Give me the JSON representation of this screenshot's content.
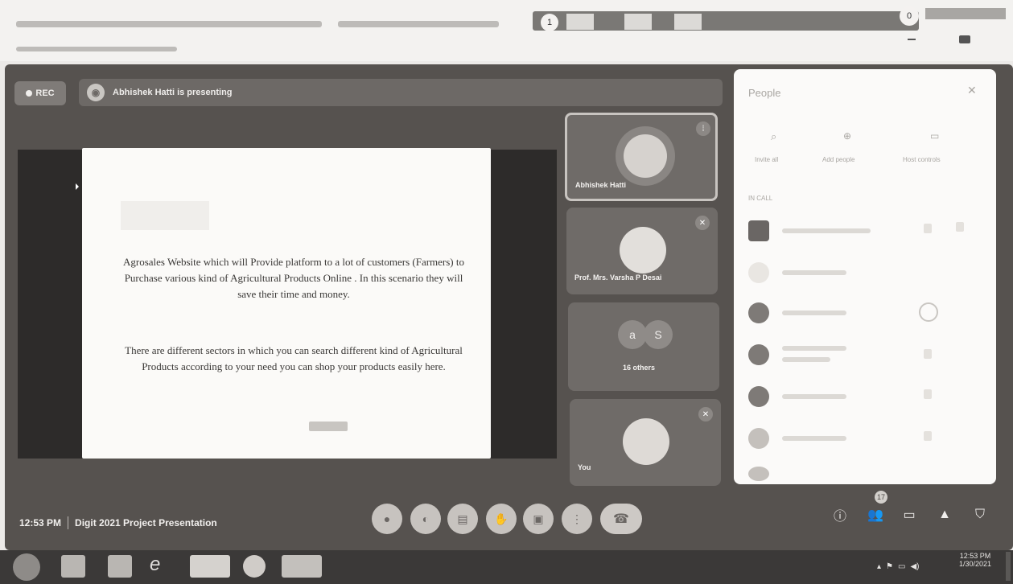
{
  "browser": {
    "tab_badge_1": "1",
    "tab_badge_2": "0"
  },
  "meeting": {
    "rec_label": "REC",
    "presenter_text": "Abhishek Hatti is presenting",
    "time": "12:53 PM",
    "title": "Digit 2021 Project Presentation"
  },
  "slide": {
    "paragraph_1": "Agrosales Website which will Provide platform to a lot of customers (Farmers) to Purchase various kind of Agricultural Products Online . In this scenario they will save their time and money.",
    "paragraph_2": "There are different sectors in which you can search different kind of Agricultural Products according to your need you can shop your products easily here."
  },
  "tiles": [
    {
      "name": "Abhishek Hatti",
      "active": true
    },
    {
      "name": "Prof. Mrs. Varsha P Desai",
      "active": false
    },
    {
      "name": "16 others",
      "initials": [
        "a",
        "S"
      ],
      "active": false
    },
    {
      "name": "You",
      "active": false
    }
  ],
  "people_panel": {
    "title": "People",
    "close_icon": "close-icon",
    "actions": [
      {
        "label": "Invite all",
        "icon": "search-icon"
      },
      {
        "label": "Add people",
        "icon": "add-person-icon"
      },
      {
        "label": "Host controls",
        "icon": "controls-icon"
      }
    ],
    "section_label": "IN CALL"
  },
  "controls": [
    {
      "name": "mic",
      "icon": "mic-icon"
    },
    {
      "name": "camera",
      "icon": "camera-icon"
    },
    {
      "name": "captions",
      "icon": "captions-icon"
    },
    {
      "name": "raise-hand",
      "icon": "hand-icon"
    },
    {
      "name": "present",
      "icon": "present-icon"
    },
    {
      "name": "more",
      "icon": "more-icon"
    }
  ],
  "side_controls": {
    "info_icon": "info-icon",
    "people_icon": "people-icon",
    "people_count": "17",
    "chat_icon": "chat-icon",
    "activities_icon": "activities-icon",
    "safety_icon": "lock-icon"
  },
  "taskbar": {
    "clock_time": "12:53 PM",
    "clock_date": "1/30/2021"
  }
}
